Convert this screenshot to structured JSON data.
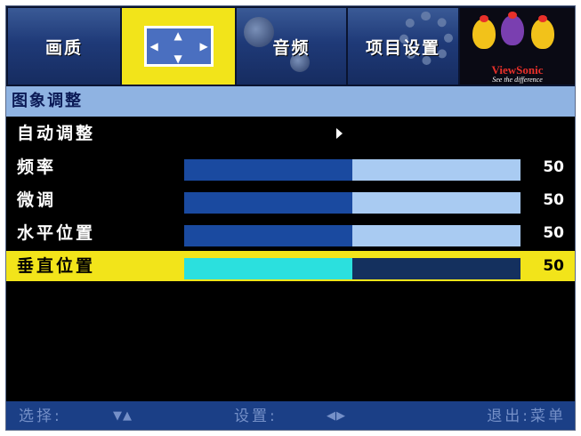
{
  "tabs": [
    {
      "label": "画质"
    },
    {
      "label": "",
      "icon": "screen-adjust-icon"
    },
    {
      "label": "音频"
    },
    {
      "label": "项目设置"
    },
    {
      "brand": "ViewSonic",
      "tagline": "See the difference"
    }
  ],
  "section_title": "图象调整",
  "rows": [
    {
      "label": "自动调整"
    },
    {
      "label": "频率",
      "value": "50",
      "level": 50
    },
    {
      "label": "微调",
      "value": "50",
      "level": 50
    },
    {
      "label": "水平位置",
      "value": "50",
      "level": 50
    },
    {
      "label": "垂直位置",
      "value": "50",
      "level": 50,
      "selected": true
    }
  ],
  "footer": {
    "select_label": "选择:",
    "select_icon": "▼▲",
    "set_label": "设置:",
    "set_icon": "◀▶",
    "exit_label": "退出:菜单"
  },
  "colors": {
    "highlight": "#f2e41a",
    "section_bg": "#8fb3e2",
    "bar_fill": "#1a4aa0",
    "bar_track": "#a9cbf2",
    "selected_fill": "#2be0de",
    "footer_bg": "#1b3f86"
  }
}
